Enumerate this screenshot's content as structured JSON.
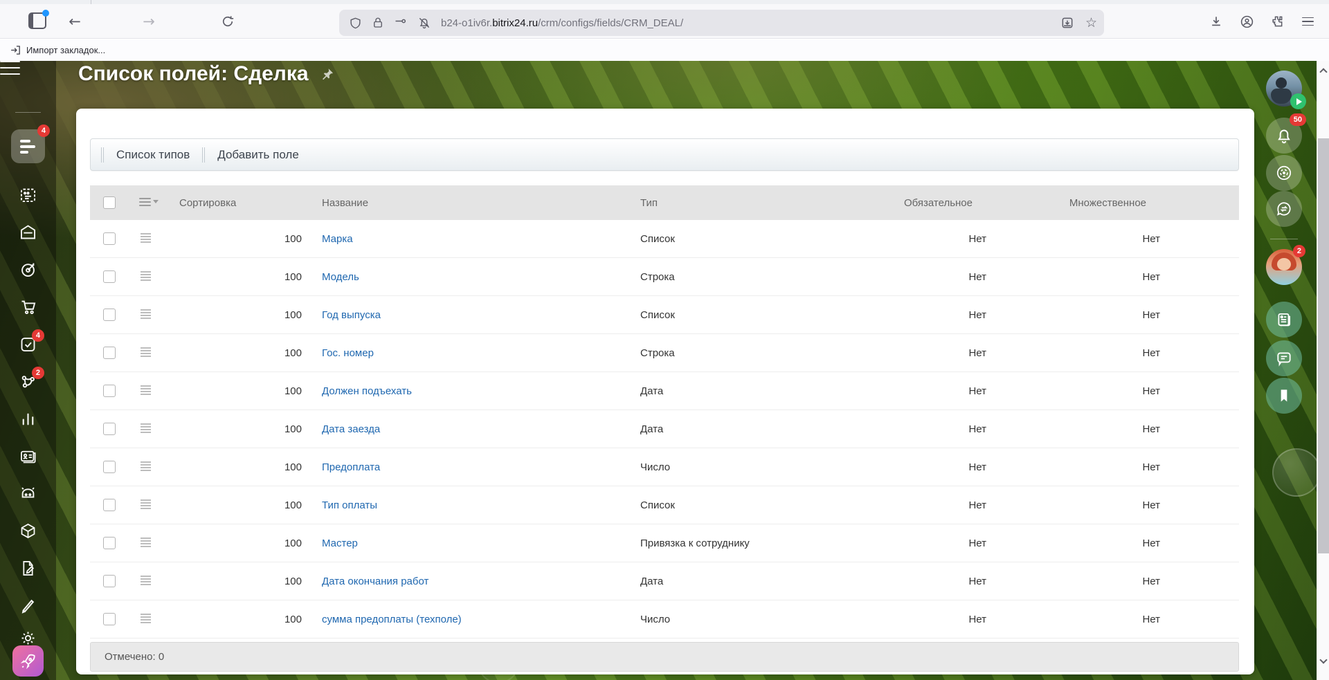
{
  "browser": {
    "url": {
      "subdomain": "b24-o1iv6r.",
      "domain": "bitrix24.ru",
      "path": "/crm/configs/fields/CRM_DEAL/"
    },
    "bookmarks": {
      "import_label": "Импорт закладок..."
    }
  },
  "page": {
    "title": "Список полей: Сделка",
    "action_bar": {
      "buttons": [
        {
          "label": "Список типов"
        },
        {
          "label": "Добавить поле"
        }
      ]
    },
    "selection_footer": "Отмечено: 0"
  },
  "table": {
    "headers": {
      "sort": "Сортировка",
      "name": "Название",
      "type": "Тип",
      "required": "Обязательное",
      "multiple": "Множественное"
    },
    "rows": [
      {
        "sort": "100",
        "name": "Марка",
        "type": "Список",
        "required": "Нет",
        "multiple": "Нет"
      },
      {
        "sort": "100",
        "name": "Модель",
        "type": "Строка",
        "required": "Нет",
        "multiple": "Нет"
      },
      {
        "sort": "100",
        "name": "Год выпуска",
        "type": "Список",
        "required": "Нет",
        "multiple": "Нет"
      },
      {
        "sort": "100",
        "name": "Гос. номер",
        "type": "Строка",
        "required": "Нет",
        "multiple": "Нет"
      },
      {
        "sort": "100",
        "name": "Должен подъехать",
        "type": "Дата",
        "required": "Нет",
        "multiple": "Нет"
      },
      {
        "sort": "100",
        "name": "Дата заезда",
        "type": "Дата",
        "required": "Нет",
        "multiple": "Нет"
      },
      {
        "sort": "100",
        "name": "Предоплата",
        "type": "Число",
        "required": "Нет",
        "multiple": "Нет"
      },
      {
        "sort": "100",
        "name": "Тип оплаты",
        "type": "Список",
        "required": "Нет",
        "multiple": "Нет"
      },
      {
        "sort": "100",
        "name": "Мастер",
        "type": "Привязка к сотруднику",
        "required": "Нет",
        "multiple": "Нет"
      },
      {
        "sort": "100",
        "name": "Дата окончания работ",
        "type": "Дата",
        "required": "Нет",
        "multiple": "Нет"
      },
      {
        "sort": "100",
        "name": "сумма предоплаты (техполе)",
        "type": "Число",
        "required": "Нет",
        "multiple": "Нет"
      }
    ]
  },
  "left_sidebar": {
    "feed_badge": "4",
    "tasks_badge": "4",
    "automation_badge": "2"
  },
  "right_rail": {
    "notifications_badge": "50",
    "messenger_badge": "2"
  },
  "toolbar_icons": {
    "back": "←",
    "forward": "→",
    "star": "☆"
  },
  "colors": {
    "link": "#2068b0",
    "badge_red": "#e53935",
    "play_badge_green": "#2fc26e",
    "rocket_gradient_from": "#f0719f",
    "rocket_gradient_to": "#b15ad2",
    "header_gray": "#e4e4e4"
  }
}
